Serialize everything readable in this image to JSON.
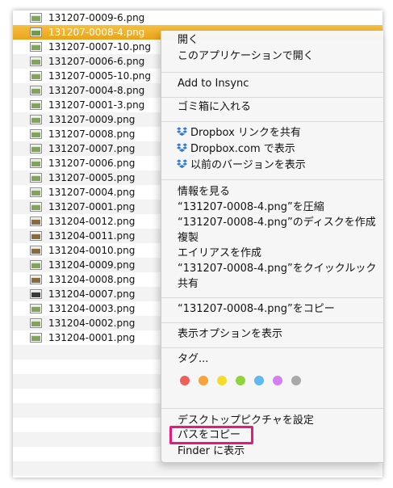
{
  "files": [
    {
      "name": "131207-0009-6.png",
      "selected": false,
      "thumb": "#7fa55a"
    },
    {
      "name": "131207-0008-4.png",
      "selected": true,
      "thumb": "#6f9a4c"
    },
    {
      "name": "131207-0007-10.png",
      "selected": false,
      "thumb": "#7fa55a"
    },
    {
      "name": "131207-0006-6.png",
      "selected": false,
      "thumb": "#7fa55a"
    },
    {
      "name": "131207-0005-10.png",
      "selected": false,
      "thumb": "#7fa55a"
    },
    {
      "name": "131207-0004-8.png",
      "selected": false,
      "thumb": "#7fa55a"
    },
    {
      "name": "131207-0001-3.png",
      "selected": false,
      "thumb": "#7fa55a"
    },
    {
      "name": "131207-0009.png",
      "selected": false,
      "thumb": "#7fa55a"
    },
    {
      "name": "131207-0008.png",
      "selected": false,
      "thumb": "#7fa55a"
    },
    {
      "name": "131207-0007.png",
      "selected": false,
      "thumb": "#7fa55a"
    },
    {
      "name": "131207-0006.png",
      "selected": false,
      "thumb": "#7fa55a"
    },
    {
      "name": "131207-0005.png",
      "selected": false,
      "thumb": "#7fa55a"
    },
    {
      "name": "131207-0004.png",
      "selected": false,
      "thumb": "#7fa55a"
    },
    {
      "name": "131207-0001.png",
      "selected": false,
      "thumb": "#7fa55a"
    },
    {
      "name": "131204-0012.png",
      "selected": false,
      "thumb": "#8c6a3a"
    },
    {
      "name": "131204-0011.png",
      "selected": false,
      "thumb": "#8c6a3a"
    },
    {
      "name": "131204-0010.png",
      "selected": false,
      "thumb": "#8c6a3a"
    },
    {
      "name": "131204-0009.png",
      "selected": false,
      "thumb": "#7fa55a"
    },
    {
      "name": "131204-0008.png",
      "selected": false,
      "thumb": "#8c6a3a"
    },
    {
      "name": "131204-0007.png",
      "selected": false,
      "thumb": "#3a3a3a"
    },
    {
      "name": "131204-0003.png",
      "selected": false,
      "thumb": "#7fa55a"
    },
    {
      "name": "131204-0002.png",
      "selected": false,
      "thumb": "#7fa55a"
    },
    {
      "name": "131204-0001.png",
      "selected": false,
      "thumb": "#7fa55a"
    }
  ],
  "menu": {
    "open": "開く",
    "open_with": "このアプリケーションで開く",
    "add_to_insync": "Add to Insync",
    "move_to_trash": "ゴミ箱に入れる",
    "dropbox_share_link": "Dropbox リンクを共有",
    "dropbox_view_web": "Dropbox.com で表示",
    "dropbox_previous_versions": "以前のバージョンを表示",
    "get_info": "情報を見る",
    "compress": "“131207-0008-4.png”を圧縮",
    "burn_to_disc": "“131207-0008-4.png”のディスクを作成",
    "duplicate": "複製",
    "make_alias": "エイリアスを作成",
    "quick_look": "“131207-0008-4.png”をクイックルック",
    "share": "共有",
    "copy_item": "“131207-0008-4.png”をコピー",
    "show_view_options": "表示オプションを表示",
    "tags": "タグ...",
    "set_desktop_picture": "デスクトップピクチャを設定",
    "copy_path": "パスをコピー",
    "reveal_in_finder": "Finder に表示"
  },
  "tag_colors": [
    "#ee5f5b",
    "#f6a33a",
    "#f5dc2b",
    "#8fd43a",
    "#5fb8f4",
    "#d57ef2",
    "#a9a9a9"
  ],
  "icons": {
    "file": "png-file-thumbnail-icon",
    "dropbox": "dropbox-icon"
  },
  "colors": {
    "selection": "#eaa41a",
    "highlight_box": "#e8197d",
    "dropbox_blue": "#2f7ad9"
  }
}
